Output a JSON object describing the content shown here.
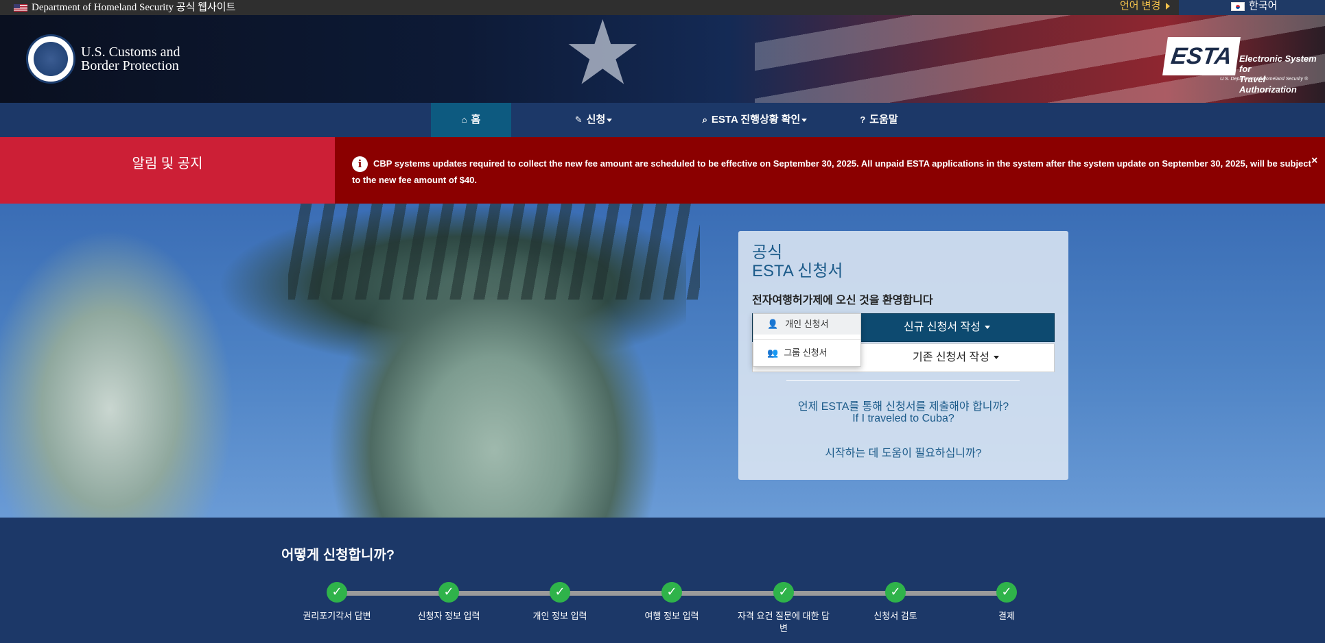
{
  "topbar": {
    "agency": "Department of Homeland Security 공식 웹사이트",
    "language_change": "언어 변경",
    "current_language": "한국어"
  },
  "header": {
    "cbp_line1": "U.S. Customs and",
    "cbp_line2": "Border Protection",
    "esta_mark": "ESTA",
    "esta_line1": "Electronic System for",
    "esta_line2": "Travel Authorization",
    "esta_dhs": "U.S. Department of Homeland Security ®"
  },
  "nav": {
    "home": "홈",
    "apply": "신청",
    "status": "ESTA 진행상황 확인",
    "help": "도움말"
  },
  "alert": {
    "label": "알림 및 공지",
    "message": "CBP systems updates required to collect the new fee amount are scheduled to be effective on September 30, 2025. All unpaid ESTA applications in the system after the system update on September 30, 2025, will be subject to the new fee amount of $40.",
    "close": "×"
  },
  "card": {
    "title_line1": "공식",
    "title_line2": "ESTA 신청서",
    "welcome": "전자여행허가제에 오신 것을 환영합니다",
    "new_application": "신규 신청서 작성",
    "existing_application": "기존 신청서 작성",
    "link_when": "언제 ESTA를 통해 신청서를 제출해야 합니까?",
    "link_cuba": "If I traveled to Cuba?",
    "link_help": "시작하는 데 도움이 필요하십니까?"
  },
  "dropdown": {
    "individual": "개인 신청서",
    "group": "그룹 신청서"
  },
  "how_to_apply": {
    "title": "어떻게 신청합니까?",
    "steps": [
      "권리포기각서 답변",
      "신청자 정보 입력",
      "개인 정보 입력",
      "여행 정보 입력",
      "자격 요건 질문에 대한 답변",
      "신청서 검토",
      "결제"
    ]
  }
}
